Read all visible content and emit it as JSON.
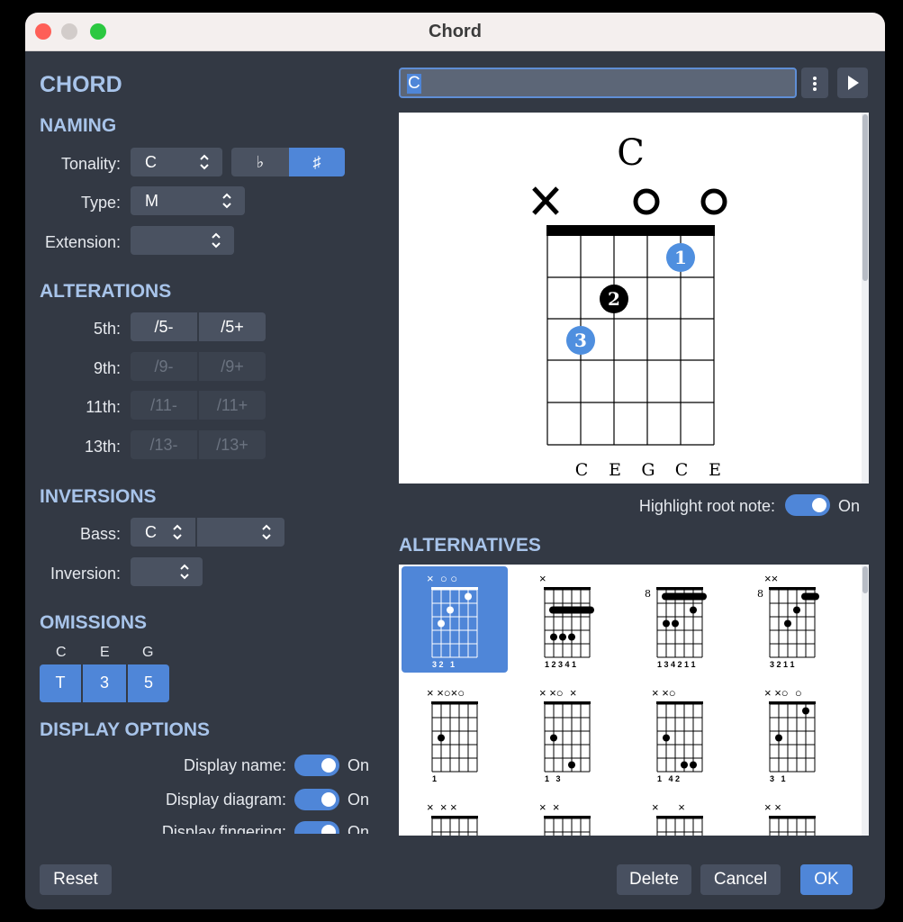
{
  "window": {
    "title": "Chord"
  },
  "left": {
    "heading": "CHORD",
    "naming": {
      "heading": "NAMING",
      "tonality_label": "Tonality:",
      "tonality_value": "C",
      "flat_symbol": "♭",
      "sharp_symbol": "♯",
      "type_label": "Type:",
      "type_value": "M",
      "extension_label": "Extension:",
      "extension_value": ""
    },
    "alterations": {
      "heading": "ALTERATIONS",
      "rows": [
        {
          "label": "5th:",
          "minus": "/5-",
          "plus": "/5+",
          "enabled": true
        },
        {
          "label": "9th:",
          "minus": "/9-",
          "plus": "/9+",
          "enabled": false
        },
        {
          "label": "11th:",
          "minus": "/11-",
          "plus": "/11+",
          "enabled": false
        },
        {
          "label": "13th:",
          "minus": "/13-",
          "plus": "/13+",
          "enabled": false
        }
      ]
    },
    "inversions": {
      "heading": "INVERSIONS",
      "bass_label": "Bass:",
      "bass_value": "C",
      "bass_second_value": "",
      "inversion_label": "Inversion:",
      "inversion_value": ""
    },
    "omissions": {
      "heading": "OMISSIONS",
      "notes": [
        "C",
        "E",
        "G"
      ],
      "buttons": [
        "T",
        "3",
        "5"
      ]
    },
    "display_options": {
      "heading": "DISPLAY OPTIONS",
      "items": [
        {
          "label": "Display name:",
          "state": "On"
        },
        {
          "label": "Display diagram:",
          "state": "On"
        },
        {
          "label": "Display fingering:",
          "state": "On"
        }
      ]
    }
  },
  "right": {
    "chord_input_value": "C",
    "more_icon": "more-vertical-icon",
    "play_icon": "play-icon",
    "diagram": {
      "chord_name": "C",
      "string_markers": [
        "×",
        "",
        "",
        "○",
        "",
        "○"
      ],
      "finger_numbers": [
        "1",
        "2",
        "3"
      ],
      "note_names": [
        "C",
        "E",
        "G",
        "C",
        "E"
      ]
    },
    "highlight_label": "Highlight root note:",
    "highlight_state": "On",
    "alternatives_heading": "ALTERNATIVES",
    "alternatives": [
      {
        "top": "×  ○ ○",
        "fret": "",
        "bottom": "3 2   1"
      },
      {
        "top": "×",
        "fret": "",
        "bottom": "1 2 3 4 1"
      },
      {
        "top": "",
        "fret": "8",
        "bottom": "1 3 4 2 1 1"
      },
      {
        "top": "××",
        "fret": "8",
        "bottom": "3 2 1 1"
      },
      {
        "top": "× ×○×○",
        "fret": "",
        "bottom": "1"
      },
      {
        "top": "× ×○  ×",
        "fret": "",
        "bottom": "1   3"
      },
      {
        "top": "× ×○",
        "fret": "",
        "bottom": "1   4 2"
      },
      {
        "top": "× ×○  ○",
        "fret": "",
        "bottom": "3   1"
      },
      {
        "top": "×  × ×",
        "fret": "",
        "bottom": ""
      },
      {
        "top": "×  ×",
        "fret": "",
        "bottom": ""
      },
      {
        "top": "×      ×",
        "fret": "",
        "bottom": ""
      },
      {
        "top": "× ×",
        "fret": "",
        "bottom": ""
      }
    ]
  },
  "footer": {
    "reset": "Reset",
    "delete": "Delete",
    "cancel": "Cancel",
    "ok": "OK"
  },
  "colors": {
    "accent": "#4f86d8",
    "heading": "#a8c4ea",
    "background": "#333944"
  }
}
